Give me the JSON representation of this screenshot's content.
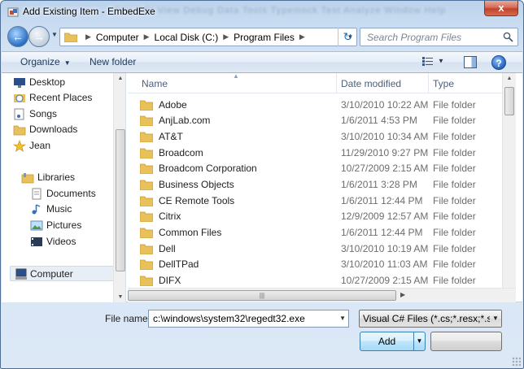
{
  "window": {
    "title": "Add Existing Item - EmbedExe",
    "close_glyph": "x",
    "bg_hint": "File   Edit   View   Debug   Data   Tools   Typemock   Test   Analyze   Window   Help"
  },
  "nav": {
    "back_glyph": "←",
    "forward_glyph": "→",
    "breadcrumbs": [
      "Computer",
      "Local Disk (C:)",
      "Program Files"
    ],
    "separator": "▶",
    "refresh_glyph": "↻",
    "search_placeholder": "Search Program Files"
  },
  "commandbar": {
    "organize": "Organize",
    "new_folder": "New folder",
    "help": "?"
  },
  "navpane": {
    "items": [
      {
        "label": "Desktop",
        "icon": "desktop-icon"
      },
      {
        "label": "Recent Places",
        "icon": "recent-places-icon"
      },
      {
        "label": "Songs",
        "icon": "songs-icon"
      },
      {
        "label": "Downloads",
        "icon": "downloads-folder-icon"
      },
      {
        "label": "Jean",
        "icon": "user-star-icon"
      },
      {
        "label": "Libraries",
        "icon": "libraries-icon"
      },
      {
        "label": "Documents",
        "icon": "documents-icon"
      },
      {
        "label": "Music",
        "icon": "music-icon"
      },
      {
        "label": "Pictures",
        "icon": "pictures-icon"
      },
      {
        "label": "Videos",
        "icon": "videos-icon"
      },
      {
        "label": "Computer",
        "icon": "computer-icon"
      }
    ]
  },
  "files": {
    "columns": [
      "Name",
      "Date modified",
      "Type"
    ],
    "rows": [
      {
        "name": "Adobe",
        "date": "3/10/2010 10:22 AM",
        "type": "File folder"
      },
      {
        "name": "AnjLab.com",
        "date": "1/6/2011 4:53 PM",
        "type": "File folder"
      },
      {
        "name": "AT&T",
        "date": "3/10/2010 10:34 AM",
        "type": "File folder"
      },
      {
        "name": "Broadcom",
        "date": "11/29/2010 9:27 PM",
        "type": "File folder"
      },
      {
        "name": "Broadcom Corporation",
        "date": "10/27/2009 2:15 AM",
        "type": "File folder"
      },
      {
        "name": "Business Objects",
        "date": "1/6/2011 3:28 PM",
        "type": "File folder"
      },
      {
        "name": "CE Remote Tools",
        "date": "1/6/2011 12:44 PM",
        "type": "File folder"
      },
      {
        "name": "Citrix",
        "date": "12/9/2009 12:57 AM",
        "type": "File folder"
      },
      {
        "name": "Common Files",
        "date": "1/6/2011 12:44 PM",
        "type": "File folder"
      },
      {
        "name": "Dell",
        "date": "3/10/2010 10:19 AM",
        "type": "File folder"
      },
      {
        "name": "DellTPad",
        "date": "3/10/2010 11:03 AM",
        "type": "File folder"
      },
      {
        "name": "DIFX",
        "date": "10/27/2009 2:15 AM",
        "type": "File folder"
      }
    ]
  },
  "bottom": {
    "filename_label": "File name:",
    "filename_value": "c:\\windows\\system32\\regedt32.exe",
    "filter_value": "Visual C# Files (*.cs;*.resx;*.setti",
    "add_label": "Add"
  },
  "colors": {
    "folder": "#e8c15a",
    "folder_dark": "#c99a2e",
    "accent": "#3c7fb1"
  }
}
